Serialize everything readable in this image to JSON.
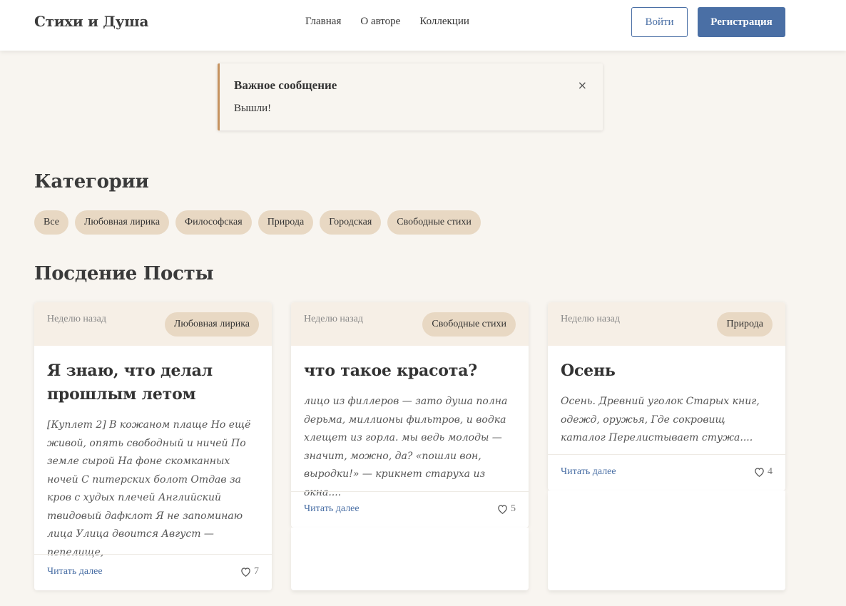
{
  "header": {
    "logo": "Стихи и Душа",
    "nav": [
      "Главная",
      "О авторе",
      "Коллекции"
    ],
    "login_label": "Войти",
    "register_label": "Регистрация"
  },
  "alert": {
    "title": "Важное сообщение",
    "text": "Вышли!",
    "close": "×"
  },
  "categories": {
    "title": "Категории",
    "items": [
      "Все",
      "Любовная лирика",
      "Философская",
      "Природа",
      "Городская",
      "Свободные стихи"
    ]
  },
  "posts": {
    "title": "Посдение Посты",
    "items": [
      {
        "date": "Неделю назад",
        "tag": "Любовная лирика",
        "title": "Я знаю, что делал прошлым летом",
        "excerpt": "[Куплет 2] В кожаном плаще Но ещё живой, опять свободный и ничей По земле сырой На фоне скомканных ночей С питерских болот Отдав за кров с худых плечей Английский твидовый дафклот Я не запоминаю лица Улица двоится Август — пепелище,",
        "read_more": "Читать далее",
        "likes": "7"
      },
      {
        "date": "Неделю назад",
        "tag": "Свободные стихи",
        "title": "что такое красота?",
        "excerpt": "лицо из филлеров — зато душа полна дерьма, миллионы фильтров, и водка хлещет из горла. мы ведь молоды — значит, можно, да? «пошли вон, выродки!» — крикнет старуха из окна....",
        "read_more": "Читать далее",
        "likes": "5"
      },
      {
        "date": "Неделю назад",
        "tag": "Природа",
        "title": "Осень",
        "excerpt": "Осень. Древний уголок Старых книг, одежд, оружья, Где сокровищ каталог Перелистывает стужа....",
        "read_more": "Читать далее",
        "likes": "4"
      }
    ]
  },
  "colors": {
    "accent": "#4a6fa5",
    "pill": "#e8d8c3",
    "background": "#f8f5f0",
    "alert_border": "#c6925f"
  }
}
